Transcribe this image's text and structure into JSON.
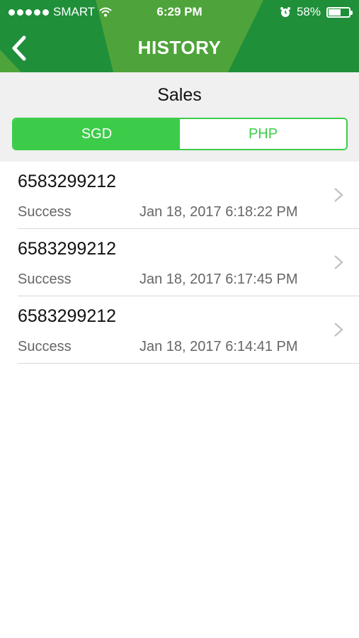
{
  "status_bar": {
    "carrier": "SMART",
    "time": "6:29 PM",
    "battery": "58%",
    "battery_level_percent": 58
  },
  "nav": {
    "title": "HISTORY",
    "back_icon": "chevron-left-icon"
  },
  "section": {
    "title": "Sales"
  },
  "segments": [
    {
      "label": "SGD",
      "active": true
    },
    {
      "label": "PHP",
      "active": false
    }
  ],
  "colors": {
    "header_green": "#1f8f3a",
    "header_shape": "#4ea33a",
    "accent_green": "#3ccc4a"
  },
  "transactions": [
    {
      "number": "6583299212",
      "status": "Success",
      "date": "Jan 18, 2017 6:18:22 PM"
    },
    {
      "number": "6583299212",
      "status": "Success",
      "date": "Jan 18, 2017 6:17:45 PM"
    },
    {
      "number": "6583299212",
      "status": "Success",
      "date": "Jan 18, 2017 6:14:41 PM"
    }
  ]
}
